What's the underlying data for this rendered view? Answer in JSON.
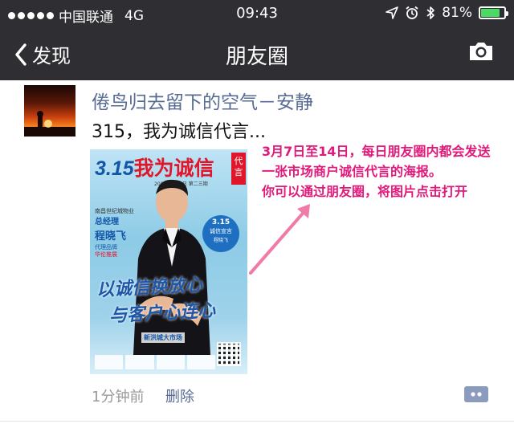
{
  "status_bar": {
    "carrier": "中国联通",
    "network": "4G",
    "time": "09:43",
    "battery": "81%",
    "battery_level": 0.81,
    "icons": [
      "signal-dots-icon",
      "location-arrow-icon",
      "alarm-clock-icon",
      "bluetooth-icon",
      "battery-icon"
    ]
  },
  "nav": {
    "back_label": "发现",
    "title": "朋友圈",
    "camera_icon": "camera-icon"
  },
  "post": {
    "username": "倦鸟归去留下的空气－安静",
    "text": "315，我为诚信代言...",
    "time_ago": "1分钟前",
    "delete_label": "删除",
    "comment_icon": "comment-icon",
    "image": {
      "headline_num": "3.15",
      "headline_text": "我为诚信",
      "side_tag": "代言",
      "subtitle": "2017年3月8日  第二三期",
      "info_line1": "南昌世纪城物业",
      "info_line2": "总经理",
      "info_name": "程晓飞",
      "info_line4": "代理品牌",
      "info_line5": "华伦推展",
      "badge_num": "3.15",
      "badge_text": "诚信宣言",
      "badge_name": "程晓飞",
      "slogan_line1": "以诚信换放心",
      "slogan_line2": "与客户心连心",
      "market_name": "新洪城大市场"
    }
  },
  "annotation": {
    "line1": "3月7日至14日，每日朋友圈内都会发送",
    "line2": "一张市场商户诚信代言的海报。",
    "line3": "你可以通过朋友圈，将图片点击打开"
  },
  "colors": {
    "nav_bg": "#2e2e33",
    "link": "#576b95",
    "annotation": "#e0197a",
    "battery": "#4cd964"
  }
}
